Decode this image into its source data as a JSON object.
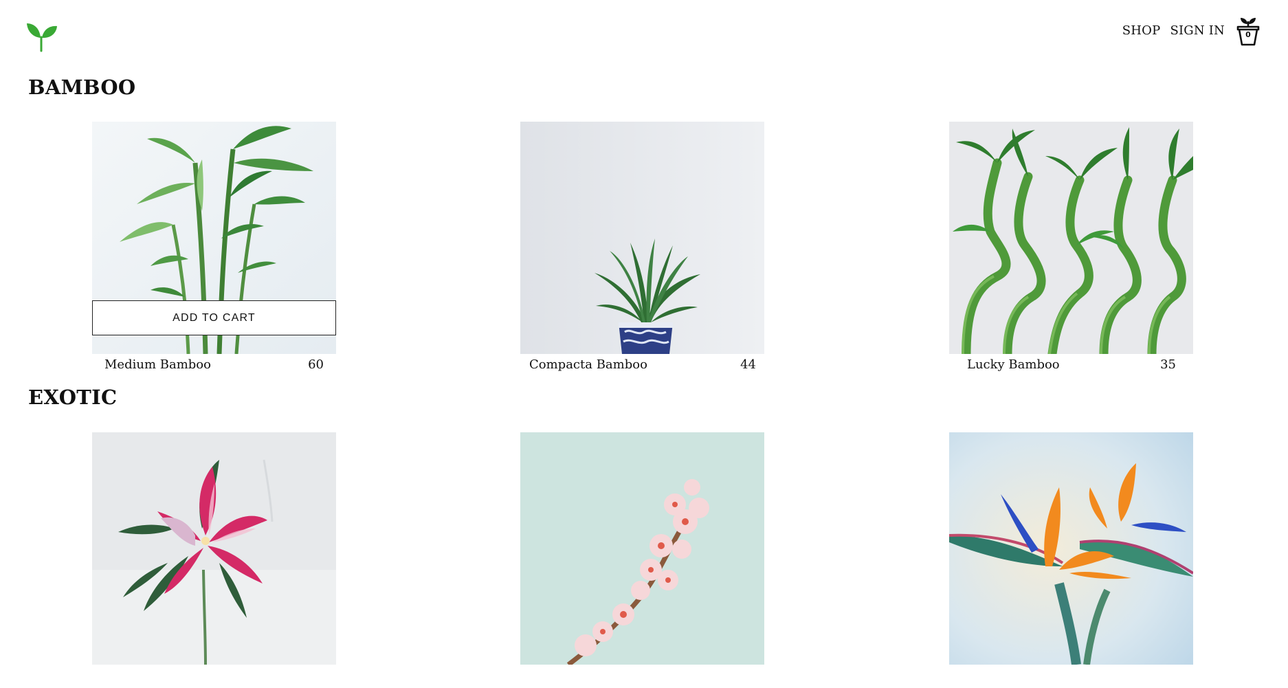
{
  "header": {
    "nav": [
      {
        "label": "SHOP"
      },
      {
        "label": "SIGN IN"
      }
    ],
    "cart_count": "0",
    "brand_color": "#3aa935"
  },
  "sections": [
    {
      "title": "BAMBOO",
      "products": [
        {
          "name": "Medium Bamboo",
          "price": "60",
          "add_to_cart": "ADD TO CART"
        },
        {
          "name": "Compacta Bamboo",
          "price": "44"
        },
        {
          "name": "Lucky Bamboo",
          "price": "35"
        }
      ]
    },
    {
      "title": "EXOTIC",
      "products": [
        {
          "name": "",
          "price": ""
        },
        {
          "name": "",
          "price": ""
        },
        {
          "name": "",
          "price": ""
        }
      ]
    }
  ]
}
